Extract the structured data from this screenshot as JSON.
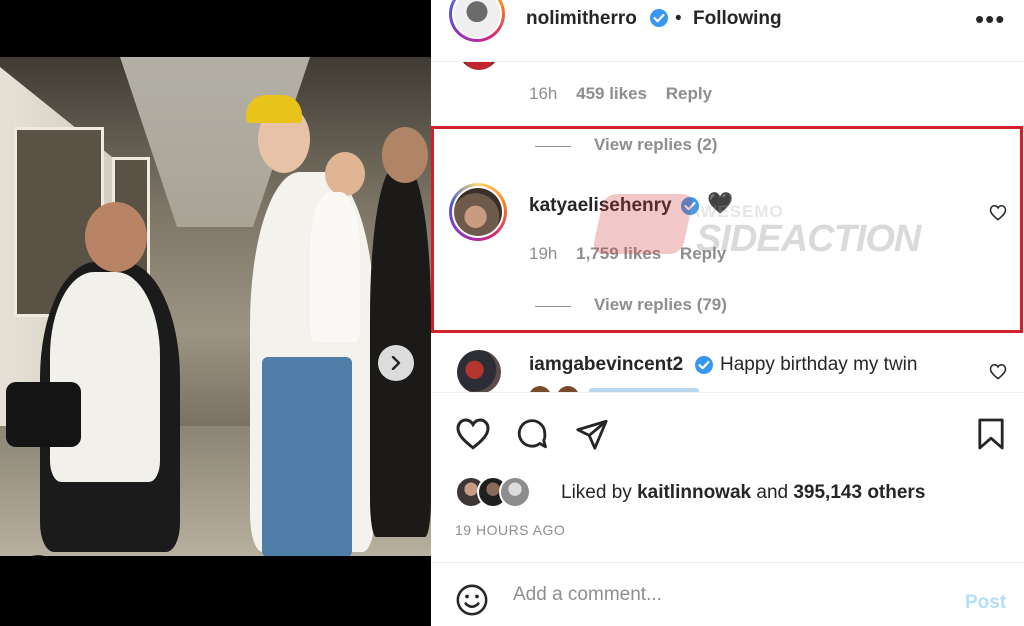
{
  "post": {
    "author": "nolimitherro",
    "follow_status": "Following",
    "bullet": "•",
    "more": "•••"
  },
  "comments": [
    {
      "meta_time": "16h",
      "meta_likes": "459 likes",
      "meta_reply": "Reply",
      "view_replies": "View replies (2)"
    },
    {
      "username": "katyaelisehenry",
      "emoji": "🖤",
      "meta_time": "19h",
      "meta_likes": "1,759 likes",
      "meta_reply": "Reply",
      "view_replies": "View replies (79)"
    },
    {
      "username": "iamgabevincent2",
      "text": "Happy birthday my twin"
    }
  ],
  "watermark": {
    "top": "AWESEMO",
    "main": "SIDEACTION"
  },
  "likes": {
    "prefix": "Liked by",
    "user": "kaitlinnowak",
    "middle": "and",
    "count": "395,143 others"
  },
  "timestamp": "19 HOURS AGO",
  "add_comment": {
    "placeholder": "Add a comment...",
    "post_label": "Post"
  },
  "media": {
    "slide_count": 6,
    "active_slide": 1
  },
  "colors": {
    "verified": "#3897f0",
    "highlight_border": "#d0212b",
    "post_disabled": "#b2dffc",
    "muted_text": "#8e8e8e"
  },
  "icons": [
    "heart-icon",
    "comment-icon",
    "share-icon",
    "bookmark-icon",
    "emoji-icon",
    "verified-icon",
    "next-arrow-icon",
    "user-tag-icon",
    "more-options-icon"
  ]
}
